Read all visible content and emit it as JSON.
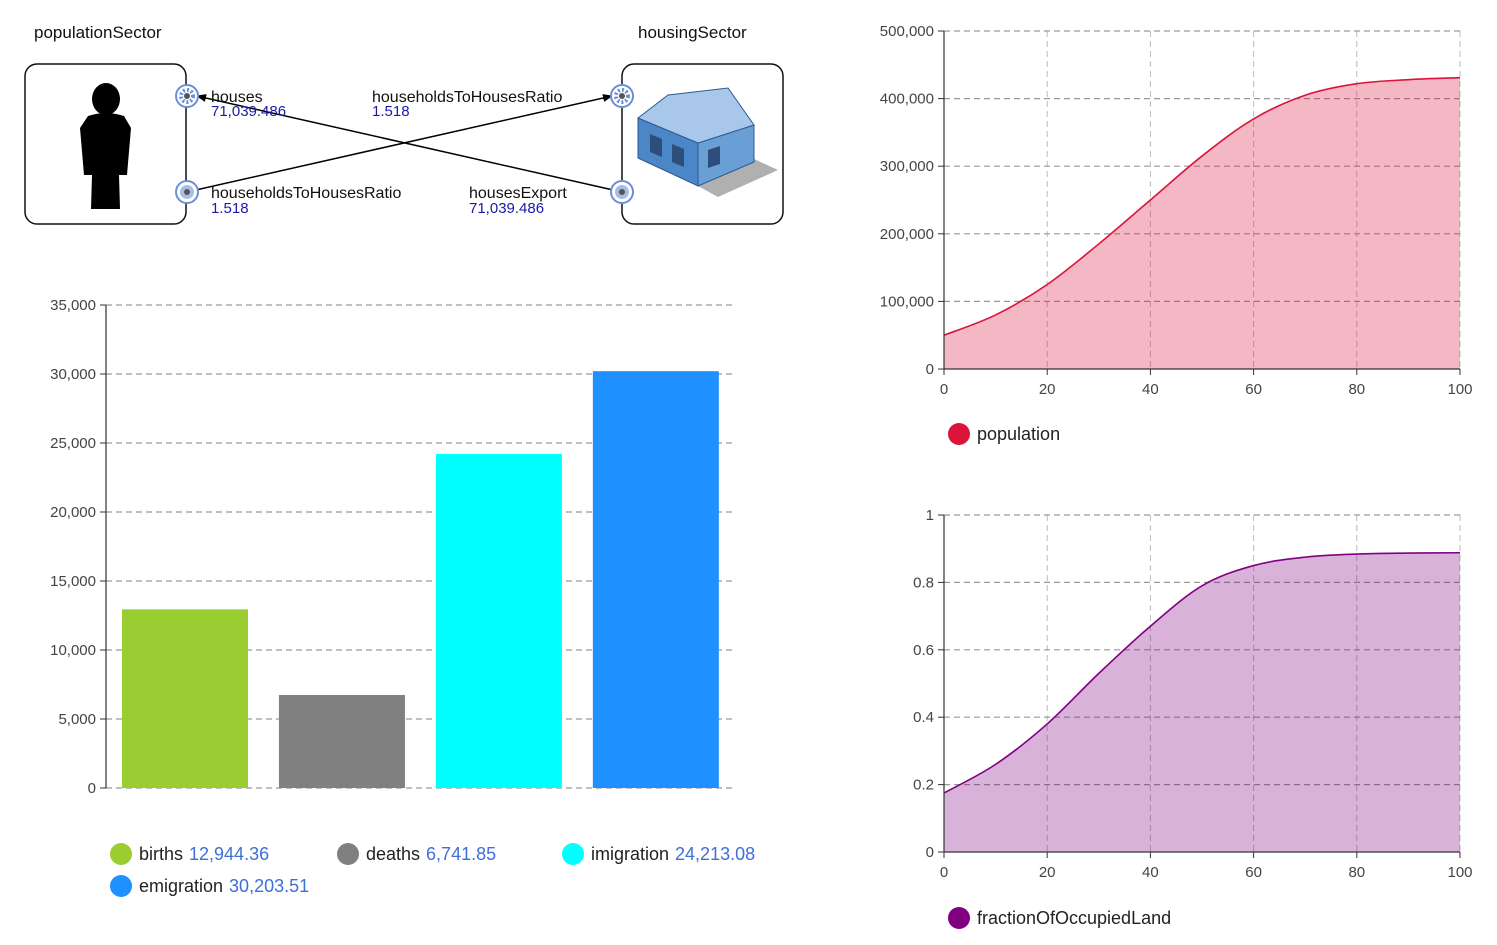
{
  "diagram": {
    "left_sector": {
      "title": "populationSector",
      "ports": [
        {
          "name": "houses",
          "value": "71,039.486",
          "kind": "input"
        },
        {
          "name": "householdsToHousesRatio",
          "value": "1.518",
          "kind": "output"
        }
      ]
    },
    "right_sector": {
      "title": "housingSector",
      "ports": [
        {
          "name": "householdsToHousesRatio",
          "value": "1.518",
          "kind": "input"
        },
        {
          "name": "housesExport",
          "value": "71,039.486",
          "kind": "output"
        }
      ]
    },
    "icons": {
      "left": "person-icon",
      "right": "house-icon"
    }
  },
  "chart_data": [
    {
      "type": "bar",
      "categories": [
        "births",
        "deaths",
        "imigration",
        "emigration"
      ],
      "values": [
        12944.36,
        6741.85,
        24213.08,
        30203.51
      ],
      "value_labels": [
        "12,944.36",
        "6,741.85",
        "24,213.08",
        "30,203.51"
      ],
      "colors": [
        "#9acd32",
        "#808080",
        "#00ffff",
        "#1e90ff"
      ],
      "ylim": [
        0,
        35000
      ],
      "yticks": [
        "0",
        "5,000",
        "10,000",
        "15,000",
        "20,000",
        "25,000",
        "30,000",
        "35,000"
      ],
      "grid": true,
      "legend": "bottom"
    },
    {
      "type": "area",
      "series": [
        {
          "name": "population",
          "color": "#dc143c",
          "x": [
            0,
            10,
            20,
            30,
            40,
            50,
            60,
            70,
            80,
            90,
            100
          ],
          "y": [
            50000,
            80000,
            125000,
            185000,
            250000,
            315000,
            370000,
            405000,
            422000,
            428000,
            431000
          ]
        }
      ],
      "xlim": [
        0,
        100
      ],
      "ylim": [
        0,
        500000
      ],
      "xticks": [
        "0",
        "20",
        "40",
        "60",
        "80",
        "100"
      ],
      "yticks": [
        "0",
        "100,000",
        "200,000",
        "300,000",
        "400,000",
        "500,000"
      ],
      "grid": true,
      "legend": "bottom"
    },
    {
      "type": "area",
      "series": [
        {
          "name": "fractionOfOccupiedLand",
          "color": "#800080",
          "x": [
            0,
            10,
            20,
            30,
            40,
            50,
            60,
            70,
            80,
            90,
            100
          ],
          "y": [
            0.175,
            0.26,
            0.38,
            0.53,
            0.67,
            0.79,
            0.85,
            0.875,
            0.884,
            0.887,
            0.888
          ]
        }
      ],
      "xlim": [
        0,
        100
      ],
      "ylim": [
        0,
        1
      ],
      "xticks": [
        "0",
        "20",
        "40",
        "60",
        "80",
        "100"
      ],
      "yticks": [
        "0",
        "0.2",
        "0.4",
        "0.6",
        "0.8",
        "1"
      ],
      "grid": true,
      "legend": "bottom"
    }
  ]
}
